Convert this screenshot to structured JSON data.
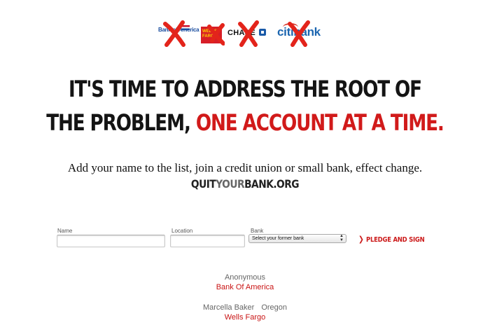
{
  "logos": [
    {
      "name": "bank-of-america",
      "text": "Bank of America",
      "crossed": true
    },
    {
      "name": "wells-fargo",
      "text": "WELLS FARGO",
      "crossed": true
    },
    {
      "name": "chase",
      "text": "CHASE",
      "crossed": true
    },
    {
      "name": "citibank",
      "text": "citibank",
      "crossed": true
    }
  ],
  "headline": {
    "line1": "IT'S TIME TO ADDRESS THE ROOT OF",
    "line2_black": "THE PROBLEM, ",
    "line2_red": "ONE ACCOUNT AT A TIME."
  },
  "subline": "Add your name to the list, join a credit union or small bank, effect change.",
  "site": {
    "part1": "QUIT",
    "part2": "YOUR",
    "part3": "BANK.ORG"
  },
  "form": {
    "name_label": "Name",
    "name_value": "",
    "location_label": "Location",
    "location_value": "",
    "bank_label": "Bank",
    "bank_selected": "Select your former bank",
    "submit_label": "PLEDGE AND SIGN"
  },
  "pledges": [
    {
      "name": "Anonymous",
      "location": "",
      "bank": "Bank Of America"
    },
    {
      "name": "Marcella Baker",
      "location": "Oregon",
      "bank": "Wells Fargo"
    }
  ],
  "colors": {
    "accent_red": "#d11a1a",
    "cross_red": "#e3241b",
    "link_red": "#c91414"
  }
}
